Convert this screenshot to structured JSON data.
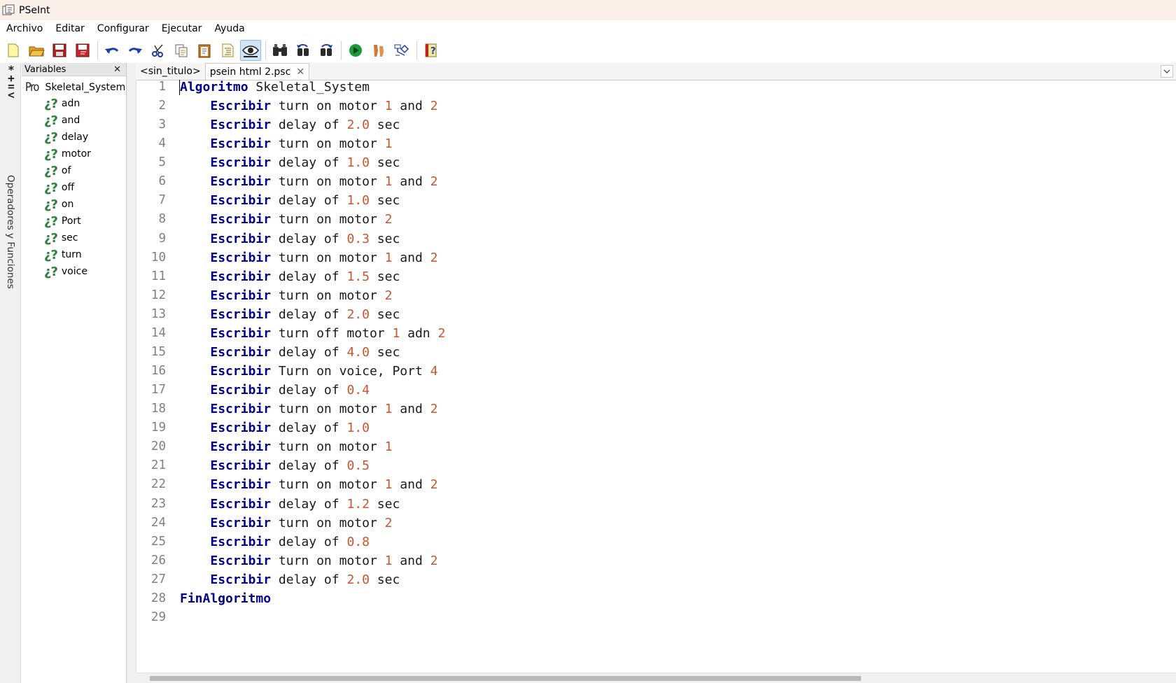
{
  "window": {
    "title": "PSeInt"
  },
  "menu": [
    "Archivo",
    "Editar",
    "Configurar",
    "Ejecutar",
    "Ayuda"
  ],
  "toolbar": {
    "buttons": [
      {
        "icon": "new-file-icon"
      },
      {
        "icon": "open-folder-icon"
      },
      {
        "icon": "save-icon"
      },
      {
        "icon": "save-as-icon"
      },
      {
        "icon": "undo-icon"
      },
      {
        "icon": "redo-icon"
      },
      {
        "icon": "cut-icon"
      },
      {
        "icon": "copy-icon"
      },
      {
        "icon": "paste-icon"
      },
      {
        "icon": "indent-icon"
      },
      {
        "icon": "preview-eye-icon"
      },
      {
        "icon": "find-binoculars-icon"
      },
      {
        "icon": "find-prev-icon"
      },
      {
        "icon": "find-next-icon"
      },
      {
        "icon": "run-icon"
      },
      {
        "icon": "step-by-step-icon"
      },
      {
        "icon": "flowchart-icon"
      },
      {
        "icon": "help-icon"
      }
    ],
    "active": "preview-eye-icon"
  },
  "side_strip": {
    "symbols": "*+=<",
    "label": "Operadores y Funciones"
  },
  "variables_panel": {
    "title": "Variables",
    "close": "✕",
    "root": {
      "prefix": "Pro",
      "label": "Skeletal_System"
    },
    "item_icon": "¿?",
    "items": [
      "adn",
      "and",
      "delay",
      "motor",
      "of",
      "off",
      "on",
      "Port",
      "sec",
      "turn",
      "voice"
    ]
  },
  "tabs": [
    {
      "label": "<sin_titulo>",
      "active": false
    },
    {
      "label": "psein html 2.psc",
      "active": true,
      "close": "✕"
    }
  ],
  "editor": {
    "lines": [
      [
        [
          "kw",
          "Algoritmo"
        ],
        [
          "t",
          " Skeletal_System"
        ]
      ],
      [
        [
          "t",
          "    "
        ],
        [
          "kw",
          "Escribir"
        ],
        [
          "t",
          " turn on motor "
        ],
        [
          "num",
          "1"
        ],
        [
          "t",
          " and "
        ],
        [
          "num",
          "2"
        ]
      ],
      [
        [
          "t",
          "    "
        ],
        [
          "kw",
          "Escribir"
        ],
        [
          "t",
          " delay of "
        ],
        [
          "num",
          "2.0"
        ],
        [
          "t",
          " sec"
        ]
      ],
      [
        [
          "t",
          "    "
        ],
        [
          "kw",
          "Escribir"
        ],
        [
          "t",
          " turn on motor "
        ],
        [
          "num",
          "1"
        ]
      ],
      [
        [
          "t",
          "    "
        ],
        [
          "kw",
          "Escribir"
        ],
        [
          "t",
          " delay of "
        ],
        [
          "num",
          "1.0"
        ],
        [
          "t",
          " sec"
        ]
      ],
      [
        [
          "t",
          "    "
        ],
        [
          "kw",
          "Escribir"
        ],
        [
          "t",
          " turn on motor "
        ],
        [
          "num",
          "1"
        ],
        [
          "t",
          " and "
        ],
        [
          "num",
          "2"
        ]
      ],
      [
        [
          "t",
          "    "
        ],
        [
          "kw",
          "Escribir"
        ],
        [
          "t",
          " delay of "
        ],
        [
          "num",
          "1.0"
        ],
        [
          "t",
          " sec"
        ]
      ],
      [
        [
          "t",
          "    "
        ],
        [
          "kw",
          "Escribir"
        ],
        [
          "t",
          " turn on motor "
        ],
        [
          "num",
          "2"
        ]
      ],
      [
        [
          "t",
          "    "
        ],
        [
          "kw",
          "Escribir"
        ],
        [
          "t",
          " delay of "
        ],
        [
          "num",
          "0.3"
        ],
        [
          "t",
          " sec"
        ]
      ],
      [
        [
          "t",
          "    "
        ],
        [
          "kw",
          "Escribir"
        ],
        [
          "t",
          " turn on motor "
        ],
        [
          "num",
          "1"
        ],
        [
          "t",
          " and "
        ],
        [
          "num",
          "2"
        ]
      ],
      [
        [
          "t",
          "    "
        ],
        [
          "kw",
          "Escribir"
        ],
        [
          "t",
          " delay of "
        ],
        [
          "num",
          "1.5"
        ],
        [
          "t",
          " sec"
        ]
      ],
      [
        [
          "t",
          "    "
        ],
        [
          "kw",
          "Escribir"
        ],
        [
          "t",
          " turn on motor "
        ],
        [
          "num",
          "2"
        ]
      ],
      [
        [
          "t",
          "    "
        ],
        [
          "kw",
          "Escribir"
        ],
        [
          "t",
          " delay of "
        ],
        [
          "num",
          "2.0"
        ],
        [
          "t",
          " sec"
        ]
      ],
      [
        [
          "t",
          "    "
        ],
        [
          "kw",
          "Escribir"
        ],
        [
          "t",
          " turn off motor "
        ],
        [
          "num",
          "1"
        ],
        [
          "t",
          " adn "
        ],
        [
          "num",
          "2"
        ]
      ],
      [
        [
          "t",
          "    "
        ],
        [
          "kw",
          "Escribir"
        ],
        [
          "t",
          " delay of "
        ],
        [
          "num",
          "4.0"
        ],
        [
          "t",
          " sec"
        ]
      ],
      [
        [
          "t",
          "    "
        ],
        [
          "kw",
          "Escribir"
        ],
        [
          "t",
          " Turn on voice, Port "
        ],
        [
          "num",
          "4"
        ]
      ],
      [
        [
          "t",
          "    "
        ],
        [
          "kw",
          "Escribir"
        ],
        [
          "t",
          " delay of "
        ],
        [
          "num",
          "0.4"
        ]
      ],
      [
        [
          "t",
          "    "
        ],
        [
          "kw",
          "Escribir"
        ],
        [
          "t",
          " turn on motor "
        ],
        [
          "num",
          "1"
        ],
        [
          "t",
          " and "
        ],
        [
          "num",
          "2"
        ]
      ],
      [
        [
          "t",
          "    "
        ],
        [
          "kw",
          "Escribir"
        ],
        [
          "t",
          " delay of "
        ],
        [
          "num",
          "1.0"
        ]
      ],
      [
        [
          "t",
          "    "
        ],
        [
          "kw",
          "Escribir"
        ],
        [
          "t",
          " turn on motor "
        ],
        [
          "num",
          "1"
        ]
      ],
      [
        [
          "t",
          "    "
        ],
        [
          "kw",
          "Escribir"
        ],
        [
          "t",
          " delay of "
        ],
        [
          "num",
          "0.5"
        ]
      ],
      [
        [
          "t",
          "    "
        ],
        [
          "kw",
          "Escribir"
        ],
        [
          "t",
          " turn on motor "
        ],
        [
          "num",
          "1"
        ],
        [
          "t",
          " and "
        ],
        [
          "num",
          "2"
        ]
      ],
      [
        [
          "t",
          "    "
        ],
        [
          "kw",
          "Escribir"
        ],
        [
          "t",
          " delay of "
        ],
        [
          "num",
          "1.2"
        ],
        [
          "t",
          " sec"
        ]
      ],
      [
        [
          "t",
          "    "
        ],
        [
          "kw",
          "Escribir"
        ],
        [
          "t",
          " turn on motor "
        ],
        [
          "num",
          "2"
        ]
      ],
      [
        [
          "t",
          "    "
        ],
        [
          "kw",
          "Escribir"
        ],
        [
          "t",
          " delay of "
        ],
        [
          "num",
          "0.8"
        ]
      ],
      [
        [
          "t",
          "    "
        ],
        [
          "kw",
          "Escribir"
        ],
        [
          "t",
          " turn on motor "
        ],
        [
          "num",
          "1"
        ],
        [
          "t",
          " and "
        ],
        [
          "num",
          "2"
        ]
      ],
      [
        [
          "t",
          "    "
        ],
        [
          "kw",
          "Escribir"
        ],
        [
          "t",
          " delay of "
        ],
        [
          "num",
          "2.0"
        ],
        [
          "t",
          " sec"
        ]
      ],
      [
        [
          "kw",
          "FinAlgoritmo"
        ]
      ],
      []
    ]
  },
  "colors": {
    "keyword": "#00008b",
    "number": "#c8552e",
    "variable_icon": "#2f7f3a",
    "titlebar": "#fbf1ea"
  }
}
